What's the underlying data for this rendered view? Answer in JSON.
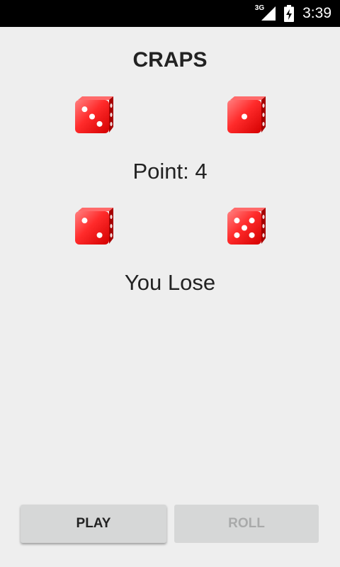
{
  "status_bar": {
    "network_type": "3G",
    "time": "3:39"
  },
  "game": {
    "title": "CRAPS",
    "point_text": "Point: 4",
    "result_text": "You Lose",
    "point_dice": [
      3,
      1
    ],
    "roll_dice": [
      2,
      5
    ]
  },
  "buttons": {
    "play_label": "PLAY",
    "roll_label": "ROLL"
  },
  "colors": {
    "die_face": "#ff2b2b",
    "die_dark": "#a60000",
    "disabled_text": "#a9aaaa"
  }
}
